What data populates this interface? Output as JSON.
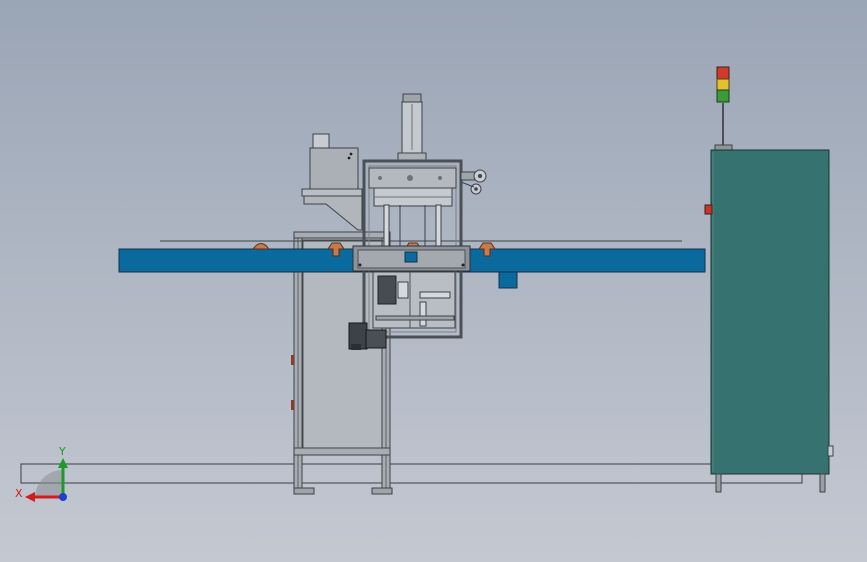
{
  "viewport": {
    "background_top": "#9aa5b5",
    "background_bottom": "#c4c8d1",
    "part_colors": {
      "frame_gray": "#a7adb3",
      "frame_dark": "#5b6168",
      "conveyor_blue": "#0a6a9e",
      "cabinet_teal": "#36726f",
      "nozzle_orange": "#c77a4a",
      "light_red": "#d13a2a",
      "light_yellow": "#e4c12c",
      "light_green": "#3d9a3a"
    }
  },
  "triad": {
    "x_label": "X",
    "y_label": "Y",
    "x_color": "#cc1f1f",
    "y_color": "#1d9a2a",
    "z_color": "#1f3fcf"
  }
}
